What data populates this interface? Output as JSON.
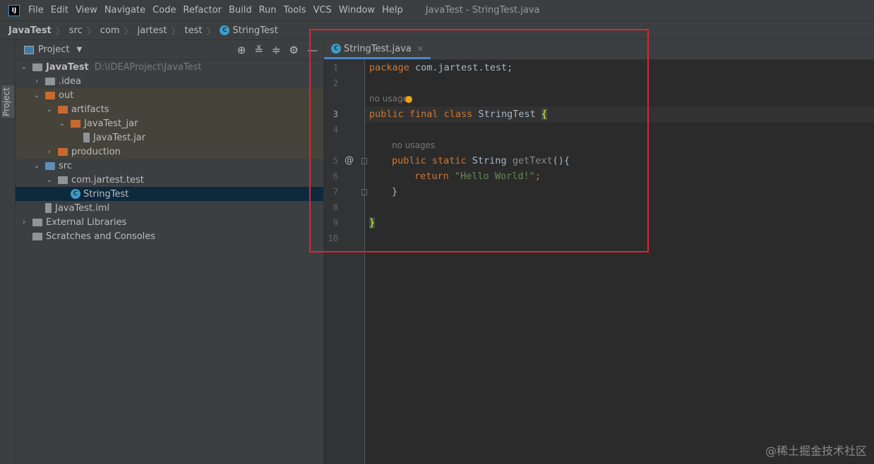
{
  "menubar": {
    "logo": "IJ",
    "items": [
      "File",
      "Edit",
      "View",
      "Navigate",
      "Code",
      "Refactor",
      "Build",
      "Run",
      "Tools",
      "VCS",
      "Window",
      "Help"
    ],
    "title": "JavaTest - StringTest.java"
  },
  "breadcrumb": [
    "JavaTest",
    "src",
    "com",
    "jartest",
    "test",
    "StringTest"
  ],
  "stripe": {
    "label": "Project"
  },
  "panel": {
    "title": "Project",
    "tree": [
      {
        "label": "JavaTest",
        "path": "D:\\IDEAProject\\JavaTest",
        "depth": 0,
        "arrow": "v",
        "icon": "module"
      },
      {
        "label": ".idea",
        "depth": 1,
        "arrow": ">",
        "icon": "folder"
      },
      {
        "label": "out",
        "depth": 1,
        "arrow": "v",
        "icon": "folder-orange"
      },
      {
        "label": "artifacts",
        "depth": 2,
        "arrow": "v",
        "icon": "folder-orange"
      },
      {
        "label": "JavaTest_jar",
        "depth": 3,
        "arrow": "v",
        "icon": "folder-orange"
      },
      {
        "label": "JavaTest.jar",
        "depth": 4,
        "arrow": "",
        "icon": "jar"
      },
      {
        "label": "production",
        "depth": 2,
        "arrow": ">",
        "icon": "folder-orange"
      },
      {
        "label": "src",
        "depth": 1,
        "arrow": "v",
        "icon": "folder-blue"
      },
      {
        "label": "com.jartest.test",
        "depth": 2,
        "arrow": "v",
        "icon": "package"
      },
      {
        "label": "StringTest",
        "depth": 3,
        "arrow": "",
        "icon": "class",
        "selected": true
      },
      {
        "label": "JavaTest.iml",
        "depth": 1,
        "arrow": "",
        "icon": "iml"
      },
      {
        "label": "External Libraries",
        "depth": 0,
        "arrow": ">",
        "icon": "libraries"
      },
      {
        "label": "Scratches and Consoles",
        "depth": 0,
        "arrow": "",
        "icon": "scratches"
      }
    ]
  },
  "editor": {
    "tab": "StringTest.java",
    "line_numbers": [
      "1",
      "2",
      "3",
      "4",
      "5",
      "6",
      "7",
      "8",
      "9",
      "10"
    ],
    "code": {
      "l1_kw": "package",
      "l1_rest": " com.jartest.test;",
      "hint1": "no usages",
      "l3_kw": "public final class",
      "l3_cls": " StringTest ",
      "brace_open": "{",
      "hint2": "no usages",
      "l5_kw": "public static",
      "l5_type": " String ",
      "l5_fn": "getText",
      "l5_rest": "(){",
      "l6_kw": "return",
      "l6_str": "\"Hello World!\"",
      "l6_end": ";",
      "l7": "}",
      "brace_close": "}",
      "at": "@"
    }
  },
  "watermark": "@稀土掘金技术社区"
}
